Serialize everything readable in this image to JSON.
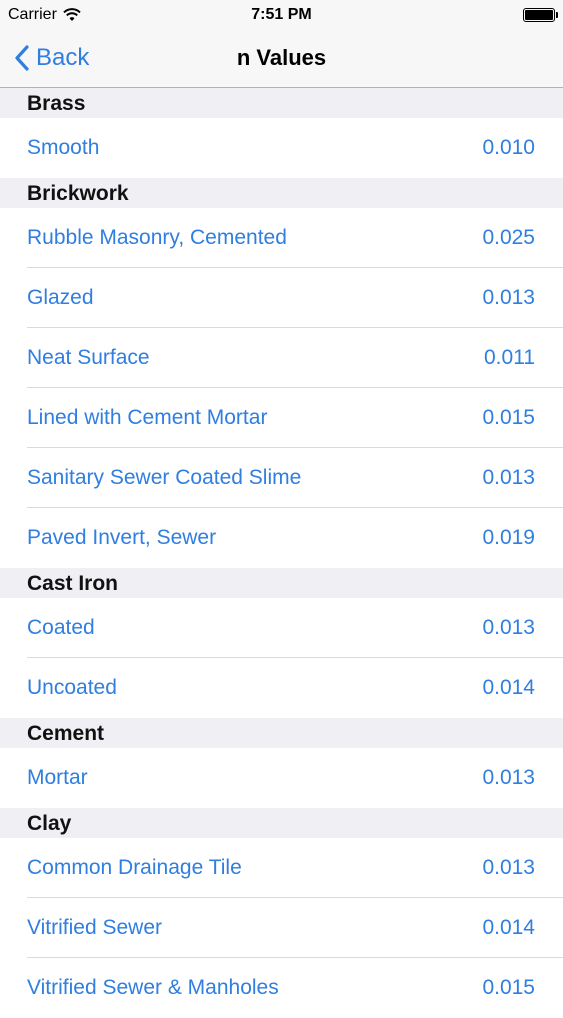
{
  "status_bar": {
    "carrier": "Carrier",
    "time": "7:51 PM",
    "wifi_icon": "wifi-icon",
    "battery_icon": "battery-icon"
  },
  "nav": {
    "back_label": "Back",
    "title": "n Values",
    "accent_color": "#2f7ee0"
  },
  "sections": [
    {
      "header": "Brass",
      "rows": [
        {
          "label": "Smooth",
          "value": "0.010"
        }
      ]
    },
    {
      "header": "Brickwork",
      "rows": [
        {
          "label": "Rubble Masonry, Cemented",
          "value": "0.025"
        },
        {
          "label": "Glazed",
          "value": "0.013"
        },
        {
          "label": "Neat Surface",
          "value": "0.011"
        },
        {
          "label": "Lined with Cement Mortar",
          "value": "0.015"
        },
        {
          "label": "Sanitary Sewer Coated Slime",
          "value": "0.013"
        },
        {
          "label": "Paved Invert, Sewer",
          "value": "0.019"
        }
      ]
    },
    {
      "header": "Cast Iron",
      "rows": [
        {
          "label": "Coated",
          "value": "0.013"
        },
        {
          "label": "Uncoated",
          "value": "0.014"
        }
      ]
    },
    {
      "header": "Cement",
      "rows": [
        {
          "label": "Mortar",
          "value": "0.013"
        }
      ]
    },
    {
      "header": "Clay",
      "rows": [
        {
          "label": "Common Drainage Tile",
          "value": "0.013"
        },
        {
          "label": "Vitrified Sewer",
          "value": "0.014"
        },
        {
          "label": "Vitrified Sewer & Manholes",
          "value": "0.015"
        }
      ]
    }
  ]
}
